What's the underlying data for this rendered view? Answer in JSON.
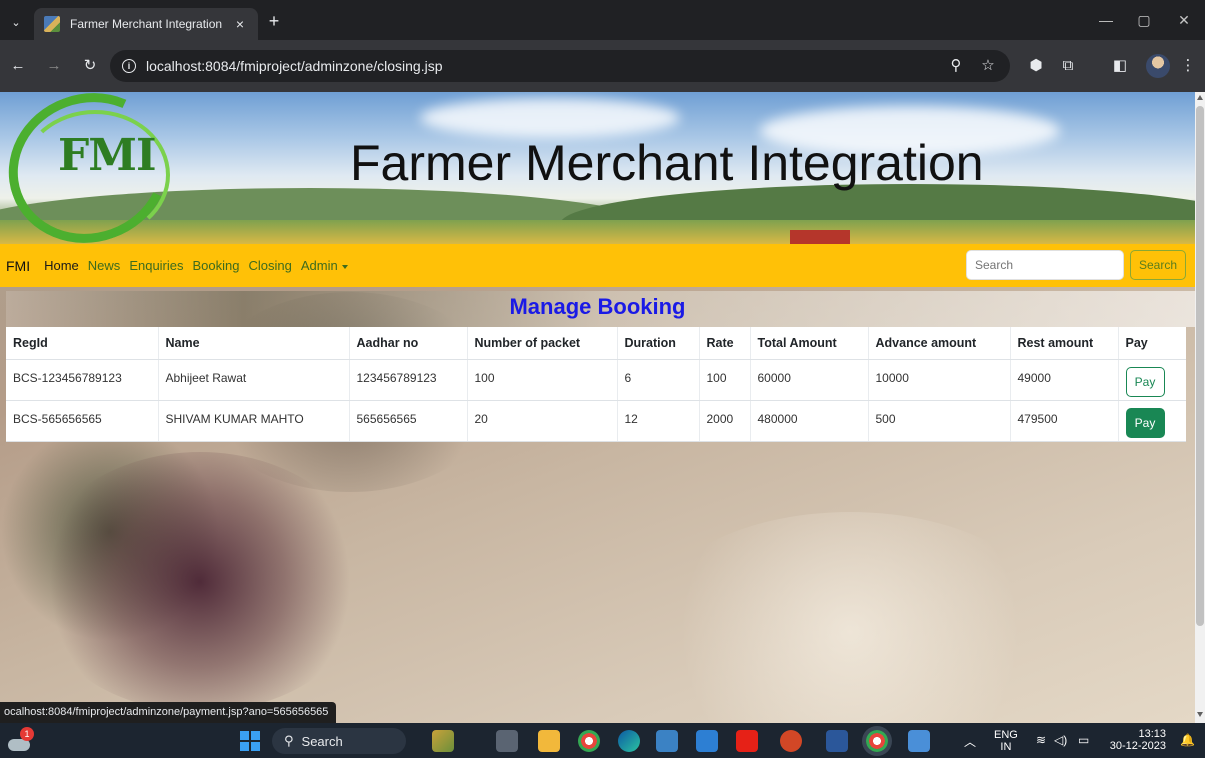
{
  "browser": {
    "tab_title": "Farmer Merchant Integration",
    "tab_close": "×",
    "new_tab": "+",
    "url": "localhost:8084/fmiproject/adminzone/closing.jsp",
    "status_url": "ocalhost:8084/fmiproject/adminzone/payment.jsp?ano=565656565"
  },
  "banner": {
    "logo_text": "FMI",
    "title": "Farmer Merchant Integration"
  },
  "navbar": {
    "brand": "FMI",
    "links": [
      "Home",
      "News",
      "Enquiries",
      "Booking",
      "Closing",
      "Admin"
    ],
    "search_placeholder": "Search",
    "search_button": "Search"
  },
  "page": {
    "heading": "Manage Booking"
  },
  "table": {
    "columns": [
      "RegId",
      "Name",
      "Aadhar no",
      "Number of packet",
      "Duration",
      "Rate",
      "Total Amount",
      "Advance amount",
      "Rest amount",
      "Pay"
    ],
    "rows": [
      {
        "regid": "BCS-123456789123",
        "name": "Abhijeet Rawat",
        "aadhar": "123456789123",
        "packets": "100",
        "duration": "6",
        "rate": "100",
        "total": "60000",
        "advance": "10000",
        "rest": "49000",
        "pay": "Pay"
      },
      {
        "regid": "BCS-565656565",
        "name": "SHIVAM KUMAR MAHTO",
        "aadhar": "565656565",
        "packets": "20",
        "duration": "12",
        "rate": "2000",
        "total": "480000",
        "advance": "500",
        "rest": "479500",
        "pay": "Pay"
      }
    ]
  },
  "taskbar": {
    "weather_badge": "1",
    "search_label": "Search",
    "lang_top": "ENG",
    "lang_bottom": "IN",
    "time": "13:13",
    "date": "30-12-2023"
  },
  "colors": {
    "navbar": "#ffc107",
    "heading": "#1a1ae6",
    "pay_button": "#198754"
  }
}
